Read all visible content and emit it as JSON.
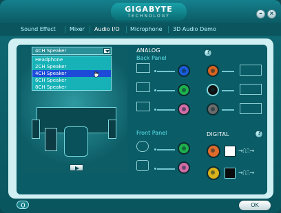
{
  "brand": {
    "name": "GIGABYTE",
    "sub": "TECHNOLOGY"
  },
  "tabs": [
    "Sound Effect",
    "Mixer",
    "Audio I/O",
    "Microphone",
    "3D Audio Demo"
  ],
  "active_tab": "Audio I/O",
  "speaker_select": {
    "selected": "4CH Speaker",
    "options": [
      "Headphone",
      "2CH Speaker",
      "4CH Speaker",
      "6CH Speaker",
      "8CH Speaker"
    ]
  },
  "sections": {
    "analog": "ANALOG",
    "back_panel": "Back Panel",
    "front_panel": "Front Panel",
    "digital": "DIGITAL"
  },
  "buttons": {
    "ok": "OK"
  },
  "colors": {
    "blue_jack": "#1a5bd9",
    "orange_jack": "#d8631f",
    "green_jack": "#1eb14c",
    "black_jack": "#101010",
    "gray_jack": "#6b6b6b",
    "pink_jack": "#d36ca8",
    "digital_orange": "#e06b2b",
    "digital_yellow": "#d9b11b"
  }
}
